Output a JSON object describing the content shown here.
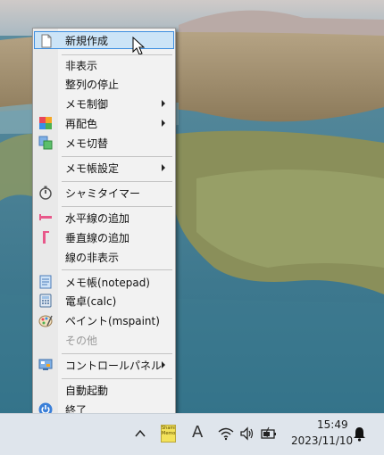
{
  "menu": {
    "items": [
      {
        "label": "新規作成",
        "icon": "new-document-icon"
      },
      {
        "label": "非表示"
      },
      {
        "label": "整列の停止"
      },
      {
        "label": "メモ制御"
      },
      {
        "label": "再配色",
        "icon": "color-palette-icon"
      },
      {
        "label": "メモ切替",
        "icon": "switch-memo-icon"
      },
      {
        "label": "メモ帳設定"
      },
      {
        "label": "シャミタイマー",
        "icon": "stopwatch-icon"
      },
      {
        "label": "水平線の追加",
        "icon": "horizontal-line-icon"
      },
      {
        "label": "垂直線の追加",
        "icon": "vertical-line-icon"
      },
      {
        "label": "線の非表示"
      },
      {
        "label": "メモ帳(notepad)",
        "icon": "notepad-icon"
      },
      {
        "label": "電卓(calc)",
        "icon": "calculator-icon"
      },
      {
        "label": "ペイント(mspaint)",
        "icon": "paint-icon"
      },
      {
        "label": "その他"
      },
      {
        "label": "コントロールパネル",
        "icon": "control-panel-icon"
      },
      {
        "label": "自動起動"
      },
      {
        "label": "終了",
        "icon": "power-icon"
      }
    ]
  },
  "taskbar": {
    "time": "15:49",
    "date": "2023/11/10",
    "app_icon_text": "Shami\nMemo",
    "ime": "A"
  },
  "colors": {
    "highlight_bg": "#cce4f7",
    "highlight_border": "#3d8ee0",
    "menu_bg": "#f2f2f2"
  }
}
